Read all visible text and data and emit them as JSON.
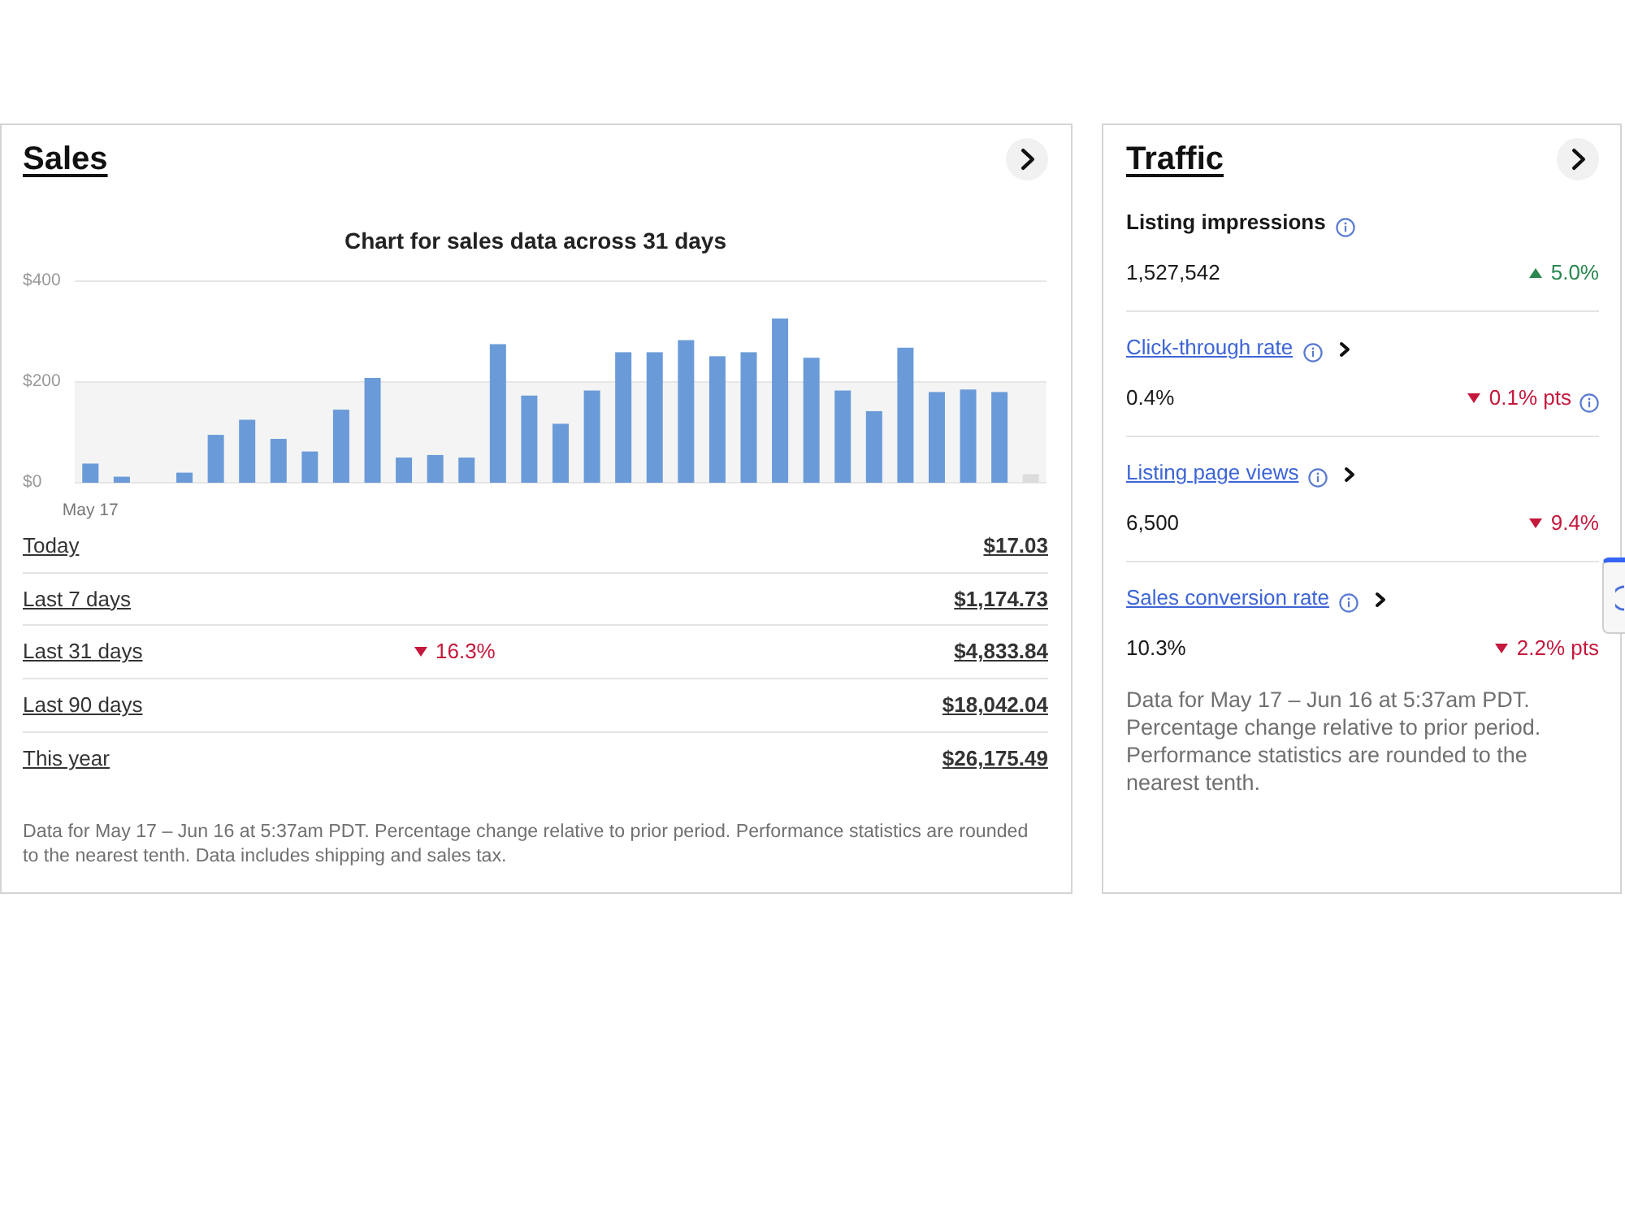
{
  "sales": {
    "title": "Sales",
    "chart": {
      "first_day_label": "May 17",
      "chart_data": {
        "type": "bar",
        "title": "Chart for sales data across 31 days",
        "series": [
          {
            "color": "#6a9bd8",
            "values": [
              38,
              12,
              0,
              20,
              95,
              125,
              87,
              62,
              145,
              208,
              50,
              55,
              50,
              275,
              173,
              117,
              183,
              259,
              259,
              283,
              251,
              259,
              326,
              248,
              183,
              142,
              268,
              180,
              185,
              180,
              null
            ]
          },
          {
            "color": "#dcdcdc",
            "values": [
              null,
              null,
              null,
              null,
              null,
              null,
              null,
              null,
              null,
              null,
              null,
              null,
              null,
              null,
              null,
              null,
              null,
              null,
              null,
              null,
              null,
              null,
              null,
              null,
              null,
              null,
              null,
              null,
              null,
              null,
              17
            ]
          }
        ],
        "stacked": true,
        "ylim": [
          0,
          400
        ],
        "yticks": [
          {
            "value": 0,
            "label": "$0"
          },
          {
            "value": 200,
            "label": "$200"
          },
          {
            "value": 400,
            "label": "$400"
          }
        ]
      }
    },
    "periods": [
      {
        "label": "Today",
        "value": "$17.03"
      },
      {
        "label": "Last 7 days",
        "value": "$1,174.73"
      },
      {
        "label": "Last 31 days",
        "value": "$4,833.84",
        "change": {
          "text": "16.3%",
          "kind": "down"
        }
      },
      {
        "label": "Last 90 days",
        "value": "$18,042.04"
      },
      {
        "label": "This year",
        "value": "$26,175.49"
      }
    ],
    "footnote": "Data for May 17 – Jun 16 at 5:37am PDT. Percentage change relative to prior period. Performance statistics are rounded to the nearest tenth. Data includes shipping and sales tax."
  },
  "traffic": {
    "title": "Traffic",
    "metrics": [
      {
        "kind": "plain",
        "label": "Listing impressions",
        "value": "1,527,542",
        "change": {
          "text": "5.0%",
          "kind": "up",
          "info": false
        }
      },
      {
        "kind": "link",
        "label": "Click-through rate",
        "value": "0.4%",
        "change": {
          "text": "0.1% pts",
          "kind": "down",
          "info": true
        }
      },
      {
        "kind": "link",
        "label": "Listing page views",
        "value": "6,500",
        "change": {
          "text": "9.4%",
          "kind": "down",
          "info": false
        }
      },
      {
        "kind": "link",
        "label": "Sales conversion rate",
        "value": "10.3%",
        "change": {
          "text": "2.2% pts",
          "kind": "down",
          "info": false
        }
      }
    ],
    "footnote": "Data for May 17 – Jun 16 at 5:37am PDT. Percentage change relative to prior period. Performance statistics are rounded to the nearest tenth."
  }
}
